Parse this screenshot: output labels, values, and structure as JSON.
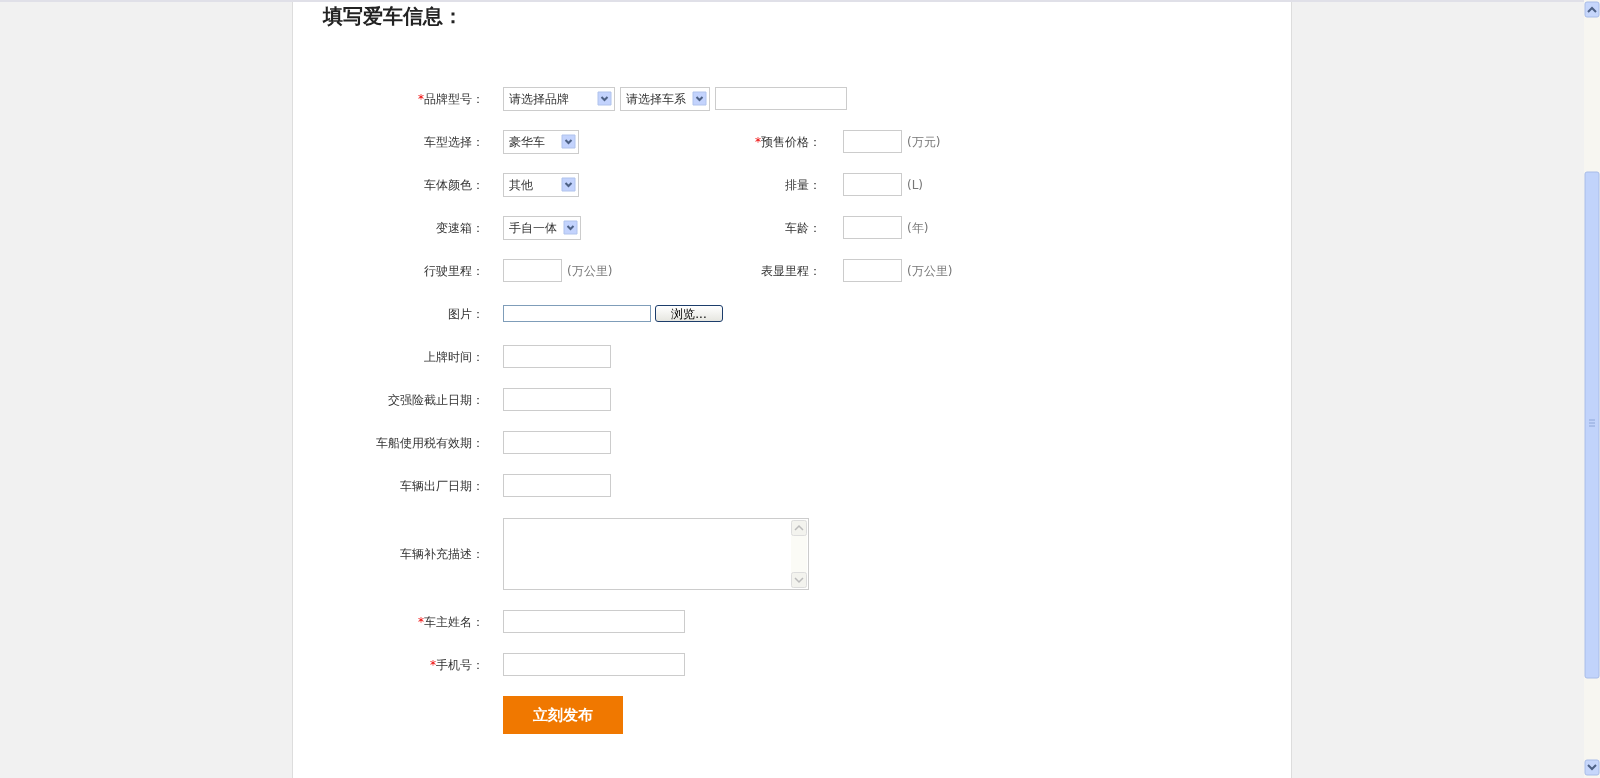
{
  "title": "填写爱车信息：",
  "rows": [
    {
      "left": {
        "required_mark": "*",
        "label": "品牌型号：",
        "controls": [
          {
            "kind": "select",
            "value": "请选择品牌"
          },
          {
            "kind": "select",
            "value": "请选择车系"
          },
          {
            "kind": "model"
          }
        ]
      }
    },
    {
      "left": {
        "label": "车型选择：",
        "controls": [
          {
            "kind": "select",
            "value": "豪华车"
          }
        ]
      },
      "right": {
        "required_mark": "*",
        "label": "预售价格：",
        "controls": [
          {
            "kind": "number"
          },
          {
            "kind": "unit",
            "text": "(万元)"
          }
        ]
      }
    },
    {
      "left": {
        "label": "车体颜色：",
        "controls": [
          {
            "kind": "select",
            "value": "其他"
          }
        ]
      },
      "right": {
        "label": "排量：",
        "controls": [
          {
            "kind": "number"
          },
          {
            "kind": "unit",
            "text": "(L)"
          }
        ]
      }
    },
    {
      "left": {
        "label": "变速箱：",
        "controls": [
          {
            "kind": "select",
            "value": "手自一体"
          }
        ]
      },
      "right": {
        "label": "车龄：",
        "controls": [
          {
            "kind": "number"
          },
          {
            "kind": "unit",
            "text": "(年)"
          }
        ]
      }
    },
    {
      "left": {
        "label": "行驶里程：",
        "controls": [
          {
            "kind": "number"
          },
          {
            "kind": "unit",
            "text": "(万公里)"
          }
        ]
      },
      "right": {
        "label": "表显里程：",
        "controls": [
          {
            "kind": "number"
          },
          {
            "kind": "unit",
            "text": "(万公里)"
          }
        ]
      }
    },
    {
      "left": {
        "label": "图片：",
        "controls": [
          {
            "kind": "file",
            "button": "浏览..."
          }
        ]
      }
    },
    {
      "left": {
        "label": "上牌时间：",
        "controls": [
          {
            "kind": "date"
          }
        ]
      }
    },
    {
      "left": {
        "label": "交强险截止日期：",
        "controls": [
          {
            "kind": "date"
          }
        ]
      }
    },
    {
      "left": {
        "label": "车船使用税有效期：",
        "controls": [
          {
            "kind": "date"
          }
        ]
      }
    },
    {
      "left": {
        "label": "车辆出厂日期：",
        "controls": [
          {
            "kind": "date"
          }
        ]
      }
    },
    {
      "left": {
        "label": "车辆补充描述：",
        "controls": [
          {
            "kind": "textarea"
          }
        ]
      }
    },
    {
      "left": {
        "required_mark": "*",
        "label": "车主姓名：",
        "controls": [
          {
            "kind": "text"
          }
        ]
      }
    },
    {
      "left": {
        "required_mark": "*",
        "label": "手机号：",
        "controls": [
          {
            "kind": "text"
          }
        ]
      }
    }
  ],
  "submit": "立刻发布"
}
